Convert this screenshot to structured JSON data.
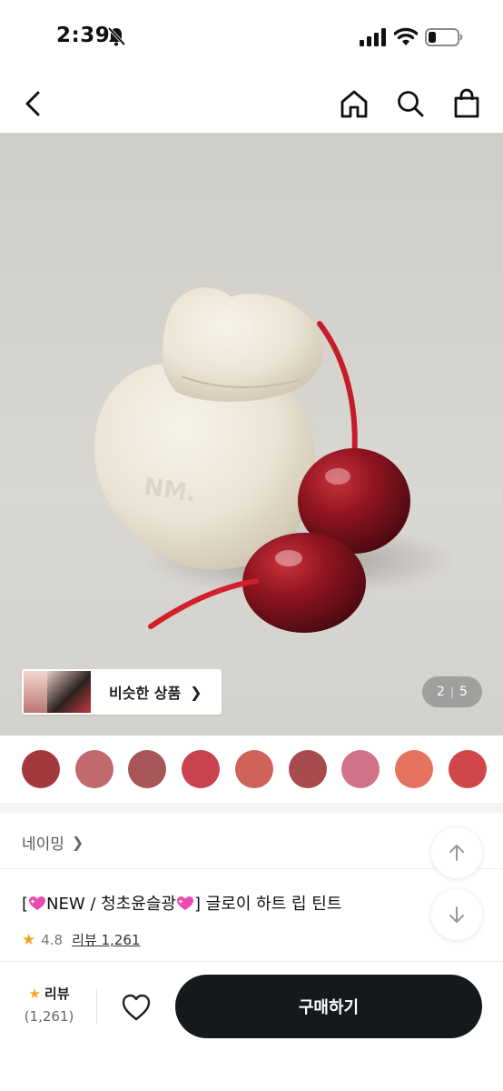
{
  "status_bar": {
    "time": "2:39",
    "icons": [
      "bell-slash-icon",
      "cellular-signal-icon",
      "wifi-icon",
      "battery-icon"
    ]
  },
  "nav": {
    "icons": [
      "back-arrow-icon",
      "home-icon",
      "search-icon",
      "shopping-bag-icon"
    ]
  },
  "gallery": {
    "similar_products_label": "비슷한 상품",
    "current_page": "2",
    "total_pages": "5"
  },
  "swatches": {
    "colors": [
      "#a3393d",
      "#c06a6e",
      "#a75559",
      "#c9434e",
      "#cf6259",
      "#a84a4e",
      "#d07389",
      "#e5735f",
      "#d0474a"
    ]
  },
  "brand": {
    "name": "네이밍"
  },
  "product": {
    "title_prefix": "[",
    "title_new": "NEW / 청초윤슬광",
    "title_suffix": "] 글로이 하트 립 틴트",
    "rating": "4.8",
    "review_label": "리뷰 1,261"
  },
  "bottom_bar": {
    "review_title": "리뷰",
    "review_count": "(1,261)",
    "buy_label": "구매하기"
  },
  "colors": {
    "accent_star": "#f5a524",
    "buy_button": "#16191c"
  }
}
